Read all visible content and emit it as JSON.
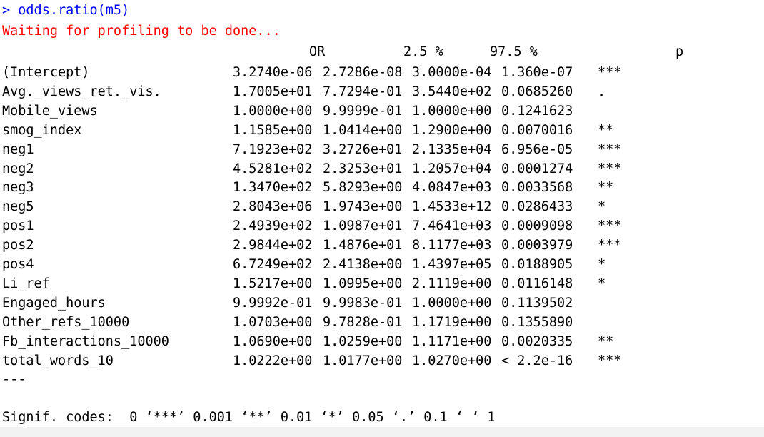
{
  "console": {
    "command": "> odds.ratio(m5)",
    "message": "Waiting for profiling to be done...",
    "header": {
      "or": "OR",
      "lo": "2.5 %",
      "hi": "97.5 %",
      "p": "p"
    },
    "rows": [
      {
        "name": "(Intercept)",
        "or": "3.2740e-06",
        "lo": "2.7286e-08",
        "hi": "3.0000e-04",
        "p": "1.360e-07",
        "sig": "***"
      },
      {
        "name": "Avg._views_ret._vis.",
        "or": "1.7005e+01",
        "lo": "7.7294e-01",
        "hi": "3.5440e+02",
        "p": "0.0685260",
        "sig": "."
      },
      {
        "name": "Mobile_views",
        "or": "1.0000e+00",
        "lo": "9.9999e-01",
        "hi": "1.0000e+00",
        "p": "0.1241623",
        "sig": ""
      },
      {
        "name": "smog_index",
        "or": "1.1585e+00",
        "lo": "1.0414e+00",
        "hi": "1.2900e+00",
        "p": "0.0070016",
        "sig": "**"
      },
      {
        "name": "neg1",
        "or": "7.1923e+02",
        "lo": "3.2726e+01",
        "hi": "2.1335e+04",
        "p": "6.956e-05",
        "sig": "***"
      },
      {
        "name": "neg2",
        "or": "4.5281e+02",
        "lo": "2.3253e+01",
        "hi": "1.2057e+04",
        "p": "0.0001274",
        "sig": "***"
      },
      {
        "name": "neg3",
        "or": "1.3470e+02",
        "lo": "5.8293e+00",
        "hi": "4.0847e+03",
        "p": "0.0033568",
        "sig": "**"
      },
      {
        "name": "neg5",
        "or": "2.8043e+06",
        "lo": "1.9743e+00",
        "hi": "1.4533e+12",
        "p": "0.0286433",
        "sig": "*"
      },
      {
        "name": "pos1",
        "or": "2.4939e+02",
        "lo": "1.0987e+01",
        "hi": "7.4641e+03",
        "p": "0.0009098",
        "sig": "***"
      },
      {
        "name": "pos2",
        "or": "2.9844e+02",
        "lo": "1.4876e+01",
        "hi": "8.1177e+03",
        "p": "0.0003979",
        "sig": "***"
      },
      {
        "name": "pos4",
        "or": "6.7249e+02",
        "lo": "2.4138e+00",
        "hi": "1.4397e+05",
        "p": "0.0188905",
        "sig": "*"
      },
      {
        "name": "Li_ref",
        "or": "1.5217e+00",
        "lo": "1.0995e+00",
        "hi": "2.1119e+00",
        "p": "0.0116148",
        "sig": "*"
      },
      {
        "name": "Engaged_hours",
        "or": "9.9992e-01",
        "lo": "9.9983e-01",
        "hi": "1.0000e+00",
        "p": "0.1139502",
        "sig": ""
      },
      {
        "name": "Other_refs_10000",
        "or": "1.0703e+00",
        "lo": "9.7828e-01",
        "hi": "1.1719e+00",
        "p": "0.1355890",
        "sig": ""
      },
      {
        "name": "Fb_interactions_10000",
        "or": "1.0690e+00",
        "lo": "1.0259e+00",
        "hi": "1.1171e+00",
        "p": "0.0020335",
        "sig": "**"
      },
      {
        "name": "total_words_10",
        "or": "1.0222e+00",
        "lo": "1.0177e+00",
        "hi": "1.0270e+00",
        "p": "< 2.2e-16",
        "sig": "***"
      }
    ],
    "separator": "---",
    "signif": "Signif. codes:  0 ‘***’ 0.001 ‘**’ 0.01 ‘*’ 0.05 ‘.’ 0.1 ‘ ’ 1"
  },
  "colors": {
    "command": "#0000ff",
    "message": "#ff0000",
    "text": "#000000",
    "background": "#ffffff"
  }
}
